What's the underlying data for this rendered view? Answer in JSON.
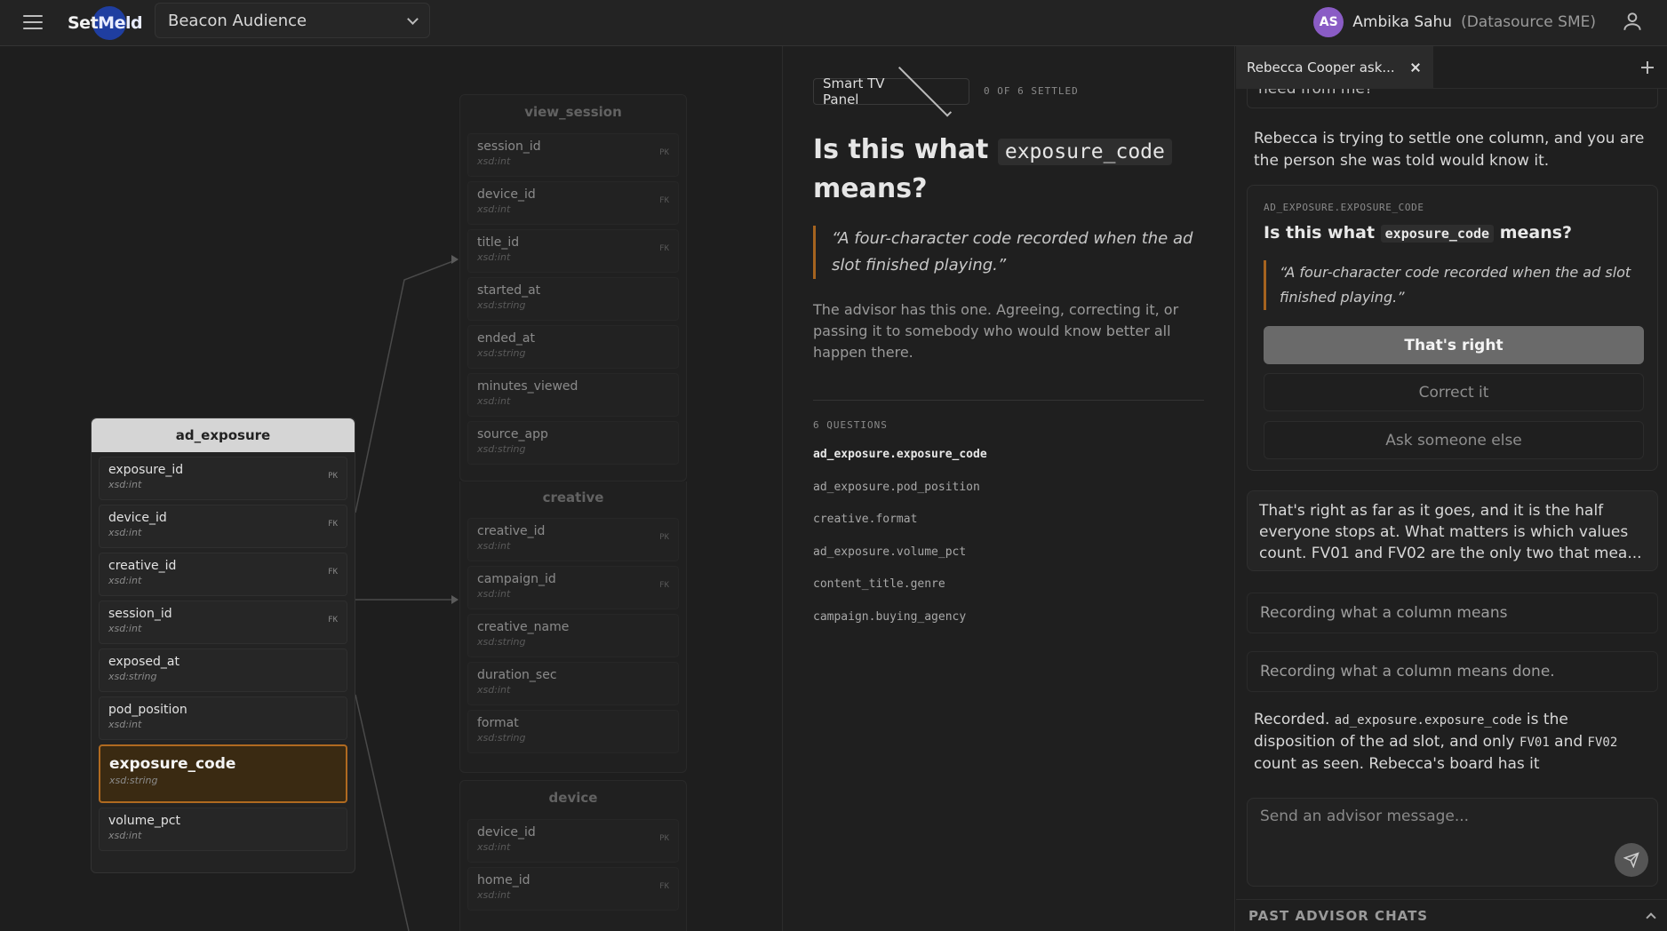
{
  "header": {
    "logo": {
      "part1": "Set",
      "part2": "Meld"
    },
    "datasource": "Beacon Audience",
    "user": {
      "initials": "AS",
      "name": "Ambika Sahu",
      "role": "(Datasource SME)"
    }
  },
  "erd": {
    "ad_exposure": {
      "name": "ad_exposure",
      "columns": [
        {
          "name": "exposure_id",
          "type": "xsd:int",
          "key": "PK"
        },
        {
          "name": "device_id",
          "type": "xsd:int",
          "key": "FK"
        },
        {
          "name": "creative_id",
          "type": "xsd:int",
          "key": "FK"
        },
        {
          "name": "session_id",
          "type": "xsd:int",
          "key": "FK"
        },
        {
          "name": "exposed_at",
          "type": "xsd:string",
          "key": ""
        },
        {
          "name": "pod_position",
          "type": "xsd:int",
          "key": ""
        },
        {
          "name": "exposure_code",
          "type": "xsd:string",
          "key": ""
        },
        {
          "name": "volume_pct",
          "type": "xsd:int",
          "key": ""
        }
      ]
    },
    "view_session": {
      "name": "view_session",
      "columns": [
        {
          "name": "session_id",
          "type": "xsd:int",
          "key": "PK"
        },
        {
          "name": "device_id",
          "type": "xsd:int",
          "key": "FK"
        },
        {
          "name": "title_id",
          "type": "xsd:int",
          "key": "FK"
        },
        {
          "name": "started_at",
          "type": "xsd:string",
          "key": ""
        },
        {
          "name": "ended_at",
          "type": "xsd:string",
          "key": ""
        },
        {
          "name": "minutes_viewed",
          "type": "xsd:int",
          "key": ""
        },
        {
          "name": "source_app",
          "type": "xsd:string",
          "key": ""
        }
      ]
    },
    "creative": {
      "name": "creative",
      "columns": [
        {
          "name": "creative_id",
          "type": "xsd:int",
          "key": "PK"
        },
        {
          "name": "campaign_id",
          "type": "xsd:int",
          "key": "FK"
        },
        {
          "name": "creative_name",
          "type": "xsd:string",
          "key": ""
        },
        {
          "name": "duration_sec",
          "type": "xsd:int",
          "key": ""
        },
        {
          "name": "format",
          "type": "xsd:string",
          "key": ""
        }
      ]
    },
    "device": {
      "name": "device",
      "columns": [
        {
          "name": "device_id",
          "type": "xsd:int",
          "key": "PK"
        },
        {
          "name": "home_id",
          "type": "xsd:int",
          "key": "FK"
        }
      ]
    }
  },
  "middle": {
    "panel": "Smart TV Panel",
    "settled": "0 OF 6 SETTLED",
    "title_pre": "Is this what",
    "title_code": "exposure_code",
    "title_post": "means?",
    "quote": "“A four-character code recorded when the ad slot finished playing.”",
    "advisor_note": "The advisor has this one. Agreeing, correcting it, or passing it to somebody who would know better all happen there.",
    "questions_label": "6 QUESTIONS",
    "questions": [
      "ad_exposure.exposure_code",
      "ad_exposure.pod_position",
      "creative.format",
      "ad_exposure.volume_pct",
      "content_title.genre",
      "campaign.buying_agency"
    ]
  },
  "chat": {
    "tab_label": "Rebecca Cooper ask...",
    "stub_text": "need from me?",
    "intro": "Rebecca is trying to settle one column, and you are the person she was told would know it.",
    "card": {
      "tag": "AD_EXPOSURE.EXPOSURE_CODE",
      "title_pre": "Is this what",
      "title_code": "exposure_code",
      "title_post": "means?",
      "quote": "“A four-character code recorded when the ad slot finished playing.”",
      "btn_right": "That's right",
      "btn_correct": "Correct it",
      "btn_ask": "Ask someone else"
    },
    "reply_line1": "That's right as far as it goes, and it is the half everyone stops at. What matters is which values count. FV01 and FV02 are the only two that mea...",
    "status1": "Recording what a column means",
    "status2": "Recording what a column means done.",
    "recorded": {
      "p1": "Recorded.",
      "code1": "ad_exposure.exposure_code",
      "p2": "is the disposition of the ad slot, and only",
      "code2": "FV01",
      "p3": "and",
      "code3": "FV02",
      "p4": "count as seen. Rebecca's board has it"
    },
    "composer_placeholder": "Send an advisor message...",
    "past_label": "PAST ADVISOR CHATS"
  }
}
